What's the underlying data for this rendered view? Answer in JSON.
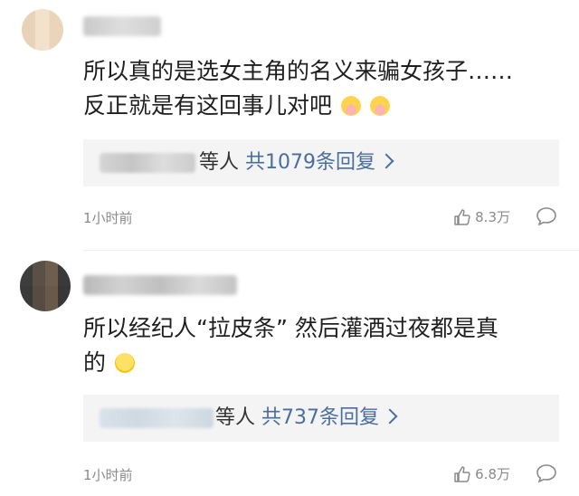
{
  "comments": [
    {
      "text_lines": [
        "所以真的是选女主角的名义来骗女孩子……",
        "反正就是有这回事儿对吧"
      ],
      "emoji": [
        "crying-face-emoji",
        "crying-face-emoji"
      ],
      "reply": {
        "others_label": "等人",
        "count_label": "共1079条回复"
      },
      "time": "1小时前",
      "likes": "8.3万"
    },
    {
      "text_lines": [
        "所以经纪人“拉皮条” 然后灌酒过夜都是真",
        "的"
      ],
      "emoji": [
        "smiling-face-emoji"
      ],
      "reply": {
        "others_label": "等人",
        "count_label": "共737条回复"
      },
      "time": "1小时前",
      "likes": "6.8万"
    }
  ],
  "colors": {
    "link": "#4a6ea0",
    "meta": "#8a8a8a",
    "reply_bg": "#f4f4f4"
  }
}
